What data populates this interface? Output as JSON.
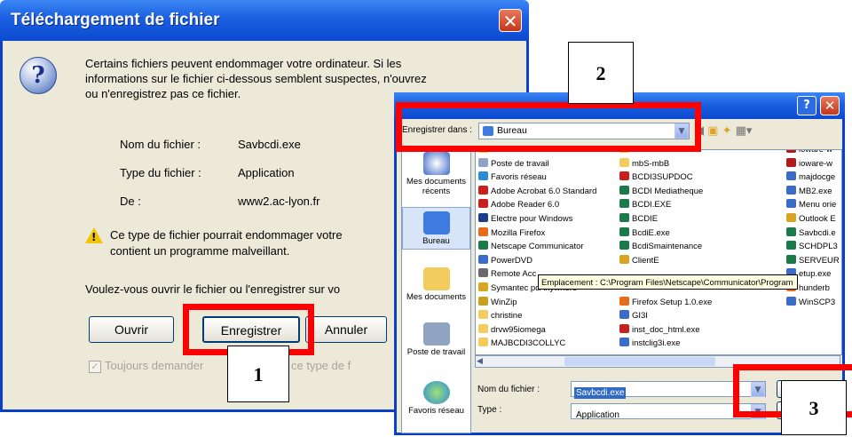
{
  "dialog1": {
    "title": "Téléchargement de fichier",
    "message_line1": "Certains fichiers peuvent endommager votre ordinateur. Si les",
    "message_line2": "informations sur le fichier ci-dessous semblent suspectes, n'ouvrez",
    "message_line3": "ou n'enregistrez pas ce fichier.",
    "name_label": "Nom du fichier :",
    "name_value": "Savbcdi.exe",
    "type_label": "Type du fichier :",
    "type_value": "Application",
    "from_label": "De :",
    "from_value": "www2.ac-lyon.fr",
    "warning_line1": "Ce type de fichier pourrait endommager votre",
    "warning_line2": "contient un programme malveillant.",
    "question": "Voulez-vous ouvrir le fichier ou l'enregistrer sur vo",
    "btn_open": "Ouvrir",
    "btn_save": "Enregistrer",
    "btn_cancel": "Annuler",
    "checkbox_label": "Toujours demander",
    "checkbox_label_tail": "ce type de f"
  },
  "dialog2": {
    "save_in_label": "Enregistrer dans :",
    "save_in_value": "Bureau",
    "sidebar": [
      "Mes documents récents",
      "Bureau",
      "Mes documents",
      "Poste de travail",
      "Favoris réseau"
    ],
    "files_col1": [
      "Mes documents",
      "Poste de travail",
      "Favoris réseau",
      "Adobe Acrobat 6.0 Standard",
      "Adobe Reader 6.0",
      "Electre pour Windows",
      "Mozilla Firefox",
      "Netscape Communicator",
      "PowerDVD",
      "Remote Acc",
      "Symantec pcAnywhere",
      "WinZip",
      "christine",
      "drvw95iomega",
      "MAJBCDI3COLLYC"
    ],
    "files_col2": [
      "mb4",
      "mbS-mbB",
      "BCDI3SUPDOC",
      "BCDI Mediatheque",
      "BCDI.EXE",
      "BCDIE",
      "BcdiE.exe",
      "BcdiSmaintenance",
      "ClientE",
      "",
      "",
      "Firefox Setup 1.0.exe",
      "GI3I",
      "inst_doc_html.exe",
      "instclig3i.exe"
    ],
    "files_col3": [
      "ioware-w",
      "ioware-w",
      "majdocge",
      "MB2.exe",
      "Menu orie",
      "Outlook E",
      "Savbcdi.e",
      "SCHDPL3",
      "SERVEUR",
      "etup.exe",
      "hunderb",
      "WinSCP3"
    ],
    "tooltip": "Emplacement : C:\\Program Files\\Netscape\\Communicator\\Program",
    "filename_label": "Nom du fichier :",
    "filename_value": "Savbcdi.exe",
    "type_label": "Type :",
    "type_value": "Application"
  },
  "annotations": [
    "1",
    "2",
    "3"
  ],
  "colors": {
    "title_blue": "#0c4ad0",
    "highlight_red": "#ff0000",
    "dialog_bg": "#ece9d8"
  }
}
